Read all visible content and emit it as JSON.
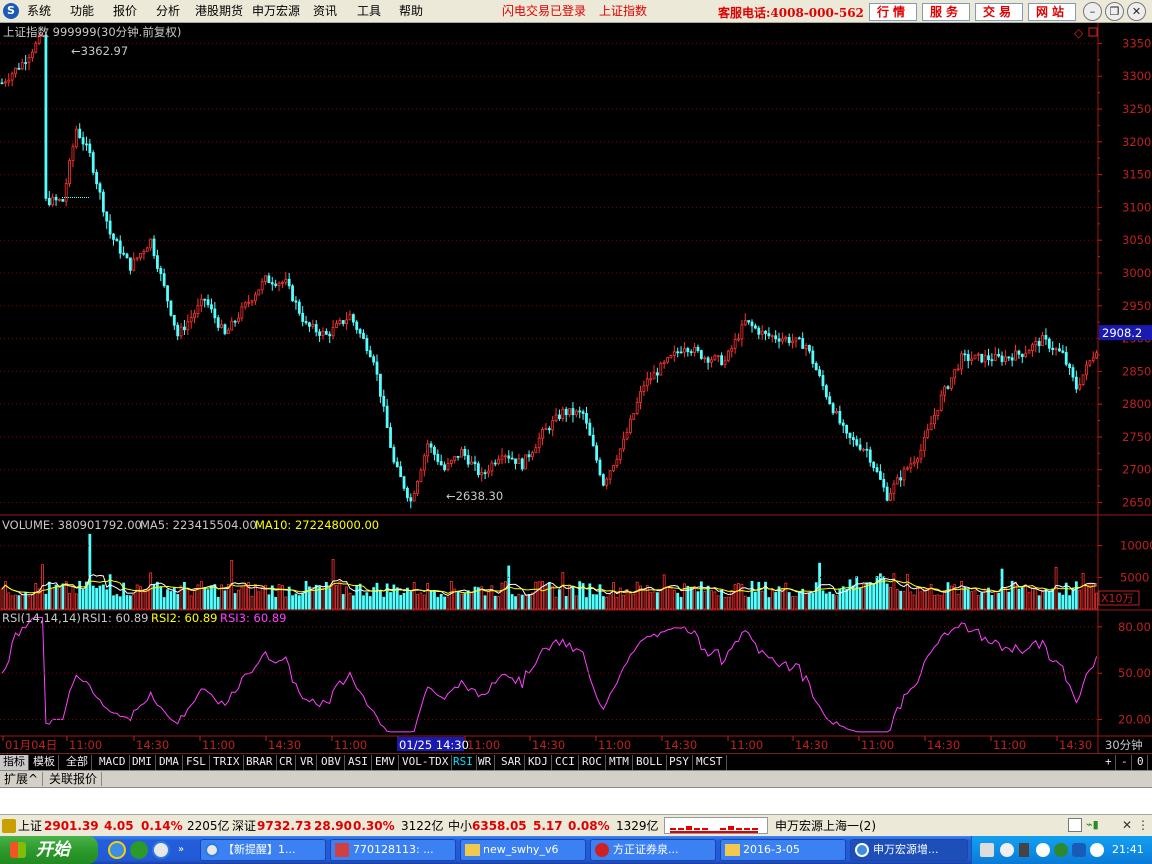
{
  "menu": {
    "items": [
      "系统",
      "功能",
      "报价",
      "分析",
      "港股期货",
      "申万宏源",
      "资讯",
      "工具",
      "帮助"
    ]
  },
  "notices": {
    "flash_login": "闪电交易已登录",
    "index_name": "上证指数"
  },
  "hotline": "客服电话:4008-000-562",
  "top_buttons": [
    "行情",
    "服务",
    "交易",
    "网站"
  ],
  "chart": {
    "title": "上证指数 999999(30分钟.前复权)",
    "high_label": "3362.97",
    "low_label": "2638.30",
    "price_axis": [
      "3350",
      "3300",
      "3250",
      "3200",
      "3150",
      "3100",
      "3050",
      "3000",
      "2950",
      "2900",
      "2850",
      "2800",
      "2750",
      "2700",
      "2650"
    ],
    "current_price_tag": "2908.2",
    "volume_caption": {
      "label": "VOLUME: 380901792.00",
      "ma5": "MA5: 223415504.00",
      "ma10": "MA10: 272248000.00"
    },
    "volume_axis": [
      "10000",
      "5000"
    ],
    "volume_unit": "X10万",
    "rsi_caption": {
      "label": "RSI(14,14,14)",
      "rsi1": "RSI1: 60.89",
      "rsi2": "RSI2: 60.89",
      "rsi3": "RSI3: 60.89"
    },
    "rsi_axis": [
      "80.00",
      "50.00",
      "20.00"
    ],
    "time_axis": [
      "01月04日",
      "11:00",
      "14:30",
      "11:00",
      "14:30",
      "11:00",
      "01/25 14:30",
      "11:00",
      "14:30",
      "11:00",
      "14:30",
      "11:00",
      "14:30",
      "11:00",
      "14:30",
      "11:00",
      "14:30"
    ],
    "period": "30分钟"
  },
  "chart_data": {
    "type": "candlestick",
    "title": "上证指数 999999(30分钟.前复权)",
    "price_range": [
      2630,
      3370
    ],
    "annotations": [
      {
        "label": "3362.97",
        "kind": "high"
      },
      {
        "label": "2638.30",
        "kind": "low"
      }
    ],
    "last_price": 2908.2,
    "volume": {
      "last": 380901792.0,
      "ma5": 223415504.0,
      "ma10": 272248000.0,
      "unit": "X10万"
    },
    "rsi": {
      "params": [
        14,
        14,
        14
      ],
      "rsi1": 60.89,
      "rsi2": 60.89,
      "rsi3": 60.89,
      "range": [
        0,
        100
      ]
    }
  },
  "indicator_tabs": {
    "category": "指标",
    "items": [
      "模板",
      "全部",
      "MACD",
      "DMI",
      "DMA",
      "FSL",
      "TRIX",
      "BRAR",
      "CR",
      "VR",
      "OBV",
      "ASI",
      "EMV",
      "VOL-TDX",
      "RSI",
      "WR",
      "SAR",
      "KDJ",
      "CCI",
      "ROC",
      "MTM",
      "BOLL",
      "PSY",
      "MCST"
    ],
    "active": "RSI"
  },
  "lower_tabs": [
    "扩展^",
    "关联报价"
  ],
  "status": {
    "sh_label": "上证",
    "sh_value": "2901.39",
    "sh_chg": "4.05",
    "sh_pct": "0.14%",
    "sh_amt": "2205亿",
    "sz_label": "深证",
    "sz_value": "9732.73",
    "sz_chg": "28.90",
    "sz_pct": "0.30%",
    "sz_amt": "3122亿",
    "zx_label": "中小",
    "zx_value": "6358.05",
    "zx_chg": "5.17",
    "zx_pct": "0.08%",
    "zx_amt": "1329亿",
    "server": "申万宏源上海一(2)"
  },
  "taskbar": {
    "start": "开始",
    "tasks": [
      "【新提醒】1...",
      "770128113: ...",
      "new_swhy_v6",
      "方正证券泉...",
      "2016-3-05",
      "申万宏源增..."
    ],
    "clock": "21:41"
  }
}
